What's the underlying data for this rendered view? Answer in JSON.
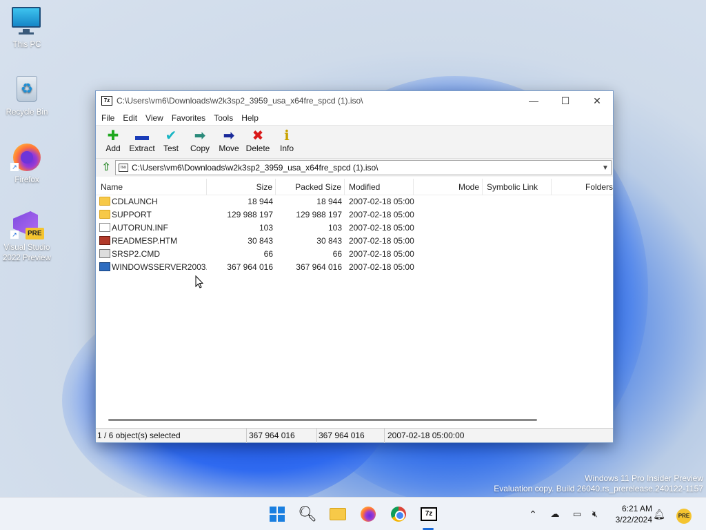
{
  "desktop": {
    "icons": [
      {
        "label": "This PC"
      },
      {
        "label": "Recycle Bin"
      },
      {
        "label": "Firefox"
      },
      {
        "label": "Visual Studio 2022 Preview",
        "badge": "PRE"
      }
    ],
    "watermark_line1": "Windows 11 Pro Insider Preview",
    "watermark_line2": "Evaluation copy. Build 26040.rs_prerelease.240122-1157"
  },
  "window": {
    "title": "C:\\Users\\vm6\\Downloads\\w2k3sp2_3959_usa_x64fre_spcd (1).iso\\",
    "app_icon": "7z",
    "menu": [
      "File",
      "Edit",
      "View",
      "Favorites",
      "Tools",
      "Help"
    ],
    "toolbar": [
      {
        "label": "Add",
        "icon": "plus-icon",
        "glyph": "✚",
        "color": "#1fa81f"
      },
      {
        "label": "Extract",
        "icon": "minus-icon",
        "glyph": "▬",
        "color": "#1a3cb8"
      },
      {
        "label": "Test",
        "icon": "check-icon",
        "glyph": "✔",
        "color": "#19b5c4"
      },
      {
        "label": "Copy",
        "icon": "copy-arrow-icon",
        "glyph": "➡",
        "color": "#2a8a7a"
      },
      {
        "label": "Move",
        "icon": "move-arrow-icon",
        "glyph": "➡",
        "color": "#1a2a9a"
      },
      {
        "label": "Delete",
        "icon": "delete-x-icon",
        "glyph": "✖",
        "color": "#d91818"
      },
      {
        "label": "Info",
        "icon": "info-icon",
        "glyph": "ℹ",
        "color": "#c9a200"
      }
    ],
    "address": "C:\\Users\\vm6\\Downloads\\w2k3sp2_3959_usa_x64fre_spcd (1).iso\\",
    "columns": {
      "name": "Name",
      "size": "Size",
      "packed": "Packed Size",
      "modified": "Modified",
      "mode": "Mode",
      "symlink": "Symbolic Link",
      "folders": "Folders"
    },
    "files": [
      {
        "name": "CDLAUNCH",
        "type": "folder",
        "size": "18 944",
        "packed": "18 944",
        "modified": "2007-02-18 05:00"
      },
      {
        "name": "SUPPORT",
        "type": "folder",
        "size": "129 988 197",
        "packed": "129 988 197",
        "modified": "2007-02-18 05:00"
      },
      {
        "name": "AUTORUN.INF",
        "type": "inf",
        "size": "103",
        "packed": "103",
        "modified": "2007-02-18 05:00"
      },
      {
        "name": "READMESP.HTM",
        "type": "htm",
        "size": "30 843",
        "packed": "30 843",
        "modified": "2007-02-18 05:00"
      },
      {
        "name": "SRSP2.CMD",
        "type": "cmd",
        "size": "66",
        "packed": "66",
        "modified": "2007-02-18 05:00"
      },
      {
        "name": "WINDOWSSERVER2003....",
        "type": "iso",
        "size": "367 964 016",
        "packed": "367 964 016",
        "modified": "2007-02-18 05:00"
      }
    ],
    "status": {
      "selected": "1 / 6 object(s) selected",
      "size": "367 964 016",
      "packed": "367 964 016",
      "modified": "2007-02-18 05:00:00"
    }
  },
  "taskbar": {
    "time": "6:21 AM",
    "date": "3/22/2024",
    "apps": [
      "start-icon",
      "search-icon",
      "file-explorer-icon",
      "firefox-icon",
      "chrome-icon",
      "7zip-icon"
    ],
    "tray_badge": "PRE"
  }
}
